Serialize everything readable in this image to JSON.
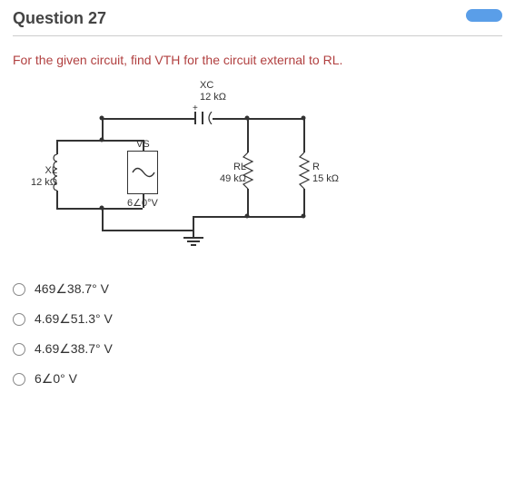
{
  "question": {
    "header": "Question 27"
  },
  "prompt": "For the given circuit, find VTH for the circuit external to RL.",
  "circuit": {
    "XL": {
      "name": "XL",
      "value": "12 kΩ"
    },
    "VS": {
      "name": "VS",
      "value": "6∠0°V"
    },
    "XC": {
      "name": "XC",
      "value": "12 kΩ"
    },
    "RL": {
      "name": "RL",
      "value": "49 kΩ"
    },
    "R": {
      "name": "R",
      "value": "15 kΩ"
    },
    "plus": "+"
  },
  "options": [
    {
      "label": "469∠38.7° V"
    },
    {
      "label": "4.69∠51.3° V"
    },
    {
      "label": "4.69∠38.7° V"
    },
    {
      "label": "6∠0° V"
    }
  ]
}
